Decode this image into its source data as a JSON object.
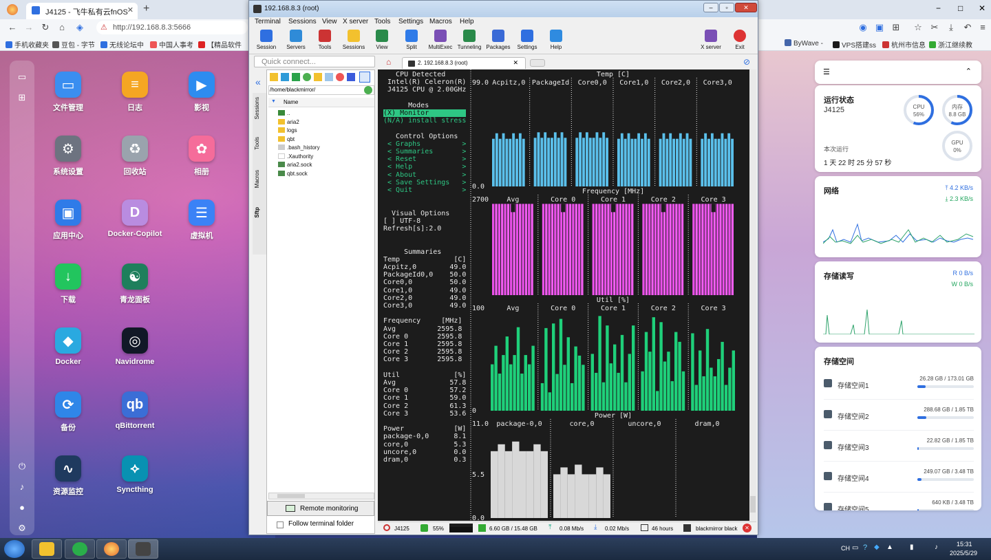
{
  "browser": {
    "tabs": [
      {
        "label": "J4125 - 飞牛私有云fnOS"
      }
    ],
    "new_tab": "+",
    "address": "http://192.168.8.3:5666",
    "bookmarks_left": [
      "手机收藏夹",
      "豆包 - 字节",
      "无线论坛中",
      "中国人事考",
      "【精品软件"
    ],
    "bookmarks_right": [
      "ByWave -",
      "VPS搭建ss",
      "杭州市信息",
      "浙江继续教"
    ],
    "window_controls": [
      "−",
      "□",
      "✕"
    ]
  },
  "apps": [
    {
      "label": "文件管理",
      "color": "#3a8ef0",
      "glyph": "▭"
    },
    {
      "label": "日志",
      "color": "#f5a623",
      "glyph": "≡"
    },
    {
      "label": "影视",
      "color": "#2d8cf0",
      "glyph": "▶"
    },
    {
      "label": "系统设置",
      "color": "#6d7380",
      "glyph": "⚙"
    },
    {
      "label": "回收站",
      "color": "#9aa3ad",
      "glyph": "♻"
    },
    {
      "label": "相册",
      "color": "#f56c9a",
      "glyph": "✿"
    },
    {
      "label": "应用中心",
      "color": "#2f7be8",
      "glyph": "▣"
    },
    {
      "label": "Docker-Copilot",
      "color": "#b98ce0",
      "glyph": "D"
    },
    {
      "label": "虚拟机",
      "color": "#3b82f6",
      "glyph": "☰"
    },
    {
      "label": "下载",
      "color": "#22c55e",
      "glyph": "↓"
    },
    {
      "label": "青龙面板",
      "color": "#1e7f5c",
      "glyph": "☯"
    },
    {
      "label": "",
      "color": "",
      "glyph": ""
    },
    {
      "label": "Docker",
      "color": "#2aa9e0",
      "glyph": "◆"
    },
    {
      "label": "Navidrome",
      "color": "#111827",
      "glyph": "◎"
    },
    {
      "label": "",
      "color": "",
      "glyph": ""
    },
    {
      "label": "备份",
      "color": "#2f86e8",
      "glyph": "⟳"
    },
    {
      "label": "qBittorrent",
      "color": "#3b6ed6",
      "glyph": "qb"
    },
    {
      "label": "",
      "color": "",
      "glyph": ""
    },
    {
      "label": "资源监控",
      "color": "#1f3a5f",
      "glyph": "∿"
    },
    {
      "label": "Syncthing",
      "color": "#0891b2",
      "glyph": "⟡"
    }
  ],
  "widgets": {
    "status": {
      "title": "运行状态",
      "host": "J4125",
      "cpu_label": "CPU",
      "cpu_value": "56%",
      "cpu_frac": 0.56,
      "mem_label": "内存",
      "mem_value": "8.8 GB",
      "mem_frac": 0.57,
      "gpu_label": "GPU",
      "gpu_value": "0%",
      "uptime_label": "本次运行",
      "uptime": "1 天 22 时 25 分 57 秒"
    },
    "network": {
      "title": "网络",
      "up": "4.2 KB/s",
      "down": "2.3 KB/s"
    },
    "disk_io": {
      "title": "存储读写",
      "read": "R 0 B/s",
      "write": "W 0 B/s"
    },
    "storage": {
      "title": "存储空间",
      "items": [
        {
          "name": "存储空间1",
          "size": "26.28 GB / 173.01 GB",
          "frac": 0.15
        },
        {
          "name": "存储空间2",
          "size": "288.68 GB / 1.85 TB",
          "frac": 0.16
        },
        {
          "name": "存储空间3",
          "size": "22.82 GB / 1.85 TB",
          "frac": 0.02
        },
        {
          "name": "存储空间4",
          "size": "249.07 GB / 3.48 TB",
          "frac": 0.07
        },
        {
          "name": "存储空间5",
          "size": "640 KB / 3.48 TB",
          "frac": 0.01
        }
      ]
    }
  },
  "moba": {
    "title": "192.168.8.3 (root)",
    "menu": [
      "Terminal",
      "Sessions",
      "View",
      "X server",
      "Tools",
      "Settings",
      "Macros",
      "Help"
    ],
    "tools": [
      "Session",
      "Servers",
      "Tools",
      "Sessions",
      "View",
      "Split",
      "MultiExec",
      "Tunneling",
      "Packages",
      "Settings",
      "Help"
    ],
    "tools_right": [
      "X server",
      "Exit"
    ],
    "quick_connect": "Quick connect...",
    "tab": "2. 192.168.8.3 (root)",
    "side_tabs": [
      "Sessions",
      "Tools",
      "Macros",
      "Sftp"
    ],
    "path": "/home/blackmirror/",
    "col_name": "Name",
    "files": [
      "..",
      "aria2",
      "logs",
      "qbt",
      ".bash_history",
      ".Xauthority",
      "aria2.sock",
      "qbt.sock"
    ],
    "remote_monitoring": "Remote monitoring",
    "follow_folder": "Follow terminal folder",
    "status": [
      "J4125",
      "55%",
      "6.60 GB / 15.48 GB",
      "0.08 Mb/s",
      "0.02 Mb/s",
      "46 hours",
      "blackmirror  black"
    ]
  },
  "terminal": {
    "left_lines": [
      "   CPU Detected",
      " Intel(R) Celeron(R)",
      " J4125 CPU @ 2.00GHz",
      "",
      "      Modes",
      "(X) Monitor",
      "(N/A) install stress",
      "",
      "   Control Options",
      " < Graphs          >",
      " < Summaries       >",
      " < Reset           >",
      " < Help            >",
      " < About           >",
      " < Save Settings   >",
      " < Quit            >",
      "",
      "",
      "  Visual Options",
      "[ ] UTF-8",
      "Refresh[s]:2.0",
      "",
      "",
      "     Summaries",
      "Temp             [C]",
      "Acpitz,0        49.0",
      "PackageId0,0    50.0",
      "Core0,0         50.0",
      "Core1,0         49.0",
      "Core2,0         49.0",
      "Core3,0         49.0",
      "",
      "Frequency     [MHz]",
      "Avg          2595.8",
      "Core 0       2595.8",
      "Core 1       2595.8",
      "Core 2       2595.8",
      "Core 3       2595.8",
      "",
      "Util             [%]",
      "Avg             57.8",
      "Core 0          57.2",
      "Core 1          59.0",
      "Core 2          61.3",
      "Core 3          53.6",
      "",
      "Power            [W]",
      "package-0,0      8.1",
      "core,0           5.3",
      "uncore,0         0.0",
      "dram,0           0.3"
    ],
    "temp": {
      "title": "Temp [C]",
      "ymax": "99.0",
      "ymin": "0.0",
      "cols": [
        "Acpitz,0",
        "PackageId",
        "Core0,0",
        "Core1,0",
        "Core2,0",
        "Core3,0"
      ],
      "values": [
        49.0,
        50.0,
        50.0,
        49.0,
        49.0,
        49.0
      ]
    },
    "freq": {
      "title": "Frequency [MHz]",
      "ymax": "2700",
      "cols": [
        "Avg",
        "Core 0",
        "Core 1",
        "Core 2",
        "Core 3"
      ],
      "values": [
        2595.8,
        2595.8,
        2595.8,
        2595.8,
        2595.8
      ]
    },
    "util": {
      "title": "Util [%]",
      "ymax": "100",
      "ymin": "0",
      "cols": [
        "Avg",
        "Core 0",
        "Core 1",
        "Core 2",
        "Core 3"
      ],
      "values": [
        57.8,
        57.2,
        59.0,
        61.3,
        53.6
      ]
    },
    "power": {
      "title": "Power [W]",
      "ymax": "11.0",
      "ymid": "5.5",
      "ymin": "0.0",
      "cols": [
        "package-0,0",
        "core,0",
        "uncore,0",
        "dram,0"
      ],
      "values": [
        8.1,
        5.3,
        0.0,
        0.3
      ]
    }
  },
  "taskbar": {
    "time": "15:31",
    "date": "2025/5/29",
    "tray": "CH"
  }
}
